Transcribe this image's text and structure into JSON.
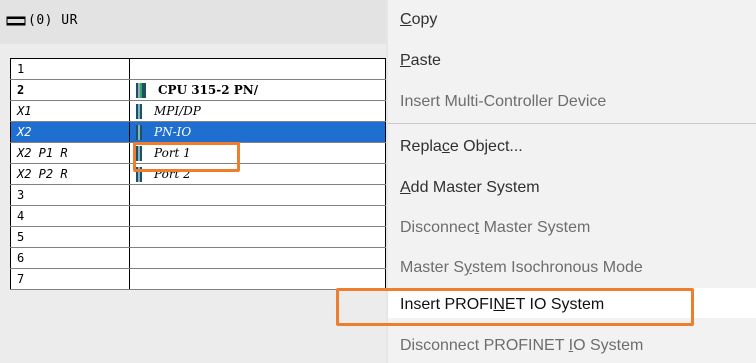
{
  "rack": {
    "title": "(0) UR",
    "rows": [
      {
        "slot": "1",
        "module": "",
        "style": "plain",
        "icon": ""
      },
      {
        "slot": "2",
        "module": "CPU 315-2 PN/",
        "style": "bold",
        "icon": "cpu-module-icon"
      },
      {
        "slot": "X1",
        "module": "MPI/DP",
        "style": "ital",
        "icon": "interface-module-icon"
      },
      {
        "slot": "X2",
        "module": "PN-IO",
        "style": "ital sel",
        "icon": "interface-module-icon"
      },
      {
        "slot": "X2 P1 R",
        "module": "Port 1",
        "style": "ital",
        "icon": "port-module-icon"
      },
      {
        "slot": "X2 P2 R",
        "module": "Port 2",
        "style": "ital",
        "icon": "port-module-icon"
      },
      {
        "slot": "3",
        "module": "",
        "style": "plain",
        "icon": ""
      },
      {
        "slot": "4",
        "module": "",
        "style": "plain",
        "icon": ""
      },
      {
        "slot": "5",
        "module": "",
        "style": "plain",
        "icon": ""
      },
      {
        "slot": "6",
        "module": "",
        "style": "plain",
        "icon": ""
      },
      {
        "slot": "7",
        "module": "",
        "style": "plain",
        "icon": ""
      }
    ]
  },
  "context_menu": {
    "items": [
      {
        "pre": "",
        "key": "C",
        "post": "opy",
        "enabled": true
      },
      {
        "pre": "",
        "key": "P",
        "post": "aste",
        "enabled": true
      },
      {
        "pre": "Insert Multi-Controller Device",
        "key": "",
        "post": "",
        "enabled": false
      },
      {
        "pre": "Repla",
        "key": "c",
        "post": "e Object...",
        "enabled": true
      },
      {
        "pre": "",
        "key": "A",
        "post": "dd Master System",
        "enabled": true
      },
      {
        "pre": "Disconnec",
        "key": "t",
        "post": " Master System",
        "enabled": false
      },
      {
        "pre": "Master S",
        "key": "y",
        "post": "stem Isochronous Mode",
        "enabled": false
      },
      {
        "pre": "Insert PROFI",
        "key": "N",
        "post": "ET IO System",
        "enabled": true,
        "highlighted": true
      },
      {
        "pre": "Disconnect PROFINET ",
        "key": "I",
        "post": "O System",
        "enabled": false
      }
    ]
  },
  "colors": {
    "accent_outline": "#ee7d2d",
    "selection": "#1f6fd1"
  }
}
